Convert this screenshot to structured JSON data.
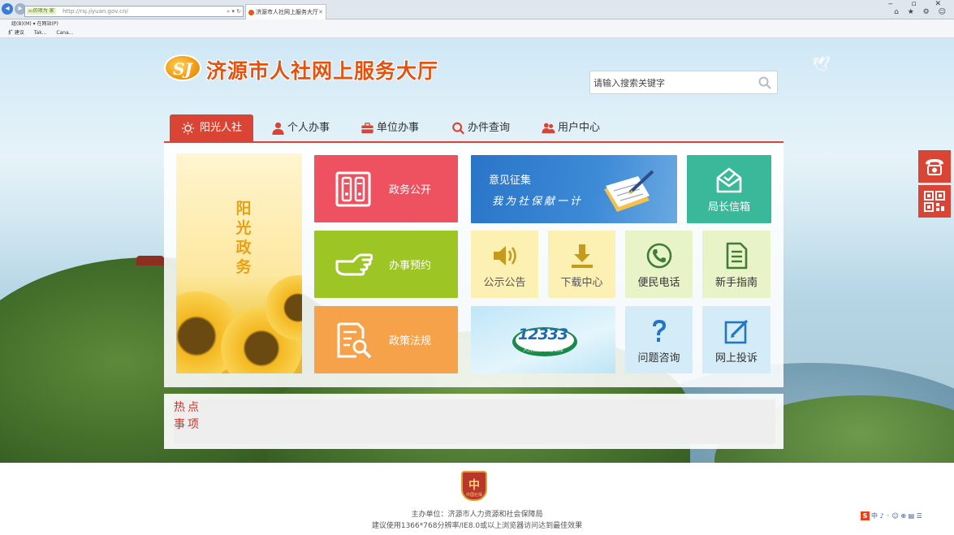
{
  "browser": {
    "url_tag": "ဆ的项为 家",
    "url": "http://rsj.jiyuan.gov.cn/",
    "tab_title": "济源市人社网上服务大厅",
    "menu_line": "组(B)(M)   ▾   在网站(P)",
    "favorites": [
      "扩 建议",
      "Tak...",
      "Cana..."
    ]
  },
  "header": {
    "logo_mark": "SJ",
    "site_title": "济源市人社网上服务大厅",
    "search_placeholder": "请输入搜索关键字"
  },
  "nav": {
    "items": [
      {
        "label": "阳光人社",
        "icon": "sun-icon"
      },
      {
        "label": "个人办事",
        "icon": "person-icon"
      },
      {
        "label": "单位办事",
        "icon": "briefcase-icon"
      },
      {
        "label": "办件查询",
        "icon": "magnifier-icon"
      },
      {
        "label": "用户中心",
        "icon": "users-icon"
      }
    ]
  },
  "banner": {
    "text": "阳光政务"
  },
  "tiles": {
    "gov_open": "政务公开",
    "appointment": "办事预约",
    "policy": "政策法规",
    "opinion_title": "意见征集",
    "opinion_slogan": "我为社保献一计",
    "mailbox": "局长信箱",
    "notice": "公示公告",
    "download": "下载中心",
    "phone": "便民电话",
    "guide": "新手指南",
    "hotline_number": "12333",
    "hotline_slogan": "人力资源 社会保障",
    "consult": "问题咨询",
    "complaint": "网上投诉"
  },
  "hot": {
    "label_line1": "热点",
    "label_line2": "事项"
  },
  "footer": {
    "emblem_char": "中",
    "emblem_sub": "中国社保",
    "sponsor": "主办单位：济源市人力资源和社会保障局",
    "suggestion": "建议使用1366*768分辨率/IE8.0或以上浏览器访问达到最佳效果",
    "ime_badge": "S",
    "ime_text": "中 ♪ ◦ ☺ ⊕ ▤ ☰"
  },
  "colors": {
    "accent": "#d94434",
    "tile_red": "#ee5160",
    "tile_green": "#9dc625",
    "tile_orange": "#f6a24a",
    "tile_teal": "#39b99a",
    "tile_blue": "#2a75c8"
  }
}
